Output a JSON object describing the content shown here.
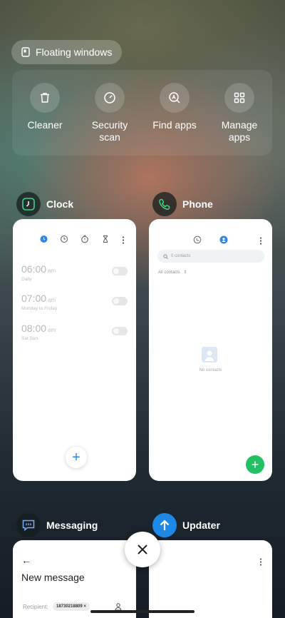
{
  "floating_windows": {
    "label": "Floating windows"
  },
  "shortcuts": [
    {
      "label": "Cleaner",
      "icon": "trash-icon"
    },
    {
      "label": "Security scan",
      "icon": "security-gauge-icon"
    },
    {
      "label": "Find apps",
      "icon": "find-apps-icon"
    },
    {
      "label": "Manage apps",
      "icon": "grid-icon"
    }
  ],
  "apps": {
    "clock": {
      "name": "Clock",
      "alarms": [
        {
          "time": "06:00",
          "ampm": "am",
          "repeat": "Daily"
        },
        {
          "time": "07:00",
          "ampm": "am",
          "repeat": "Monday to Friday"
        },
        {
          "time": "08:00",
          "ampm": "am",
          "repeat": "Sat Sun"
        }
      ],
      "add_label": "+"
    },
    "phone": {
      "name": "Phone",
      "search_placeholder": "0 contacts",
      "filter_label": "All contacts",
      "empty_text": "No contacts",
      "add_label": "+"
    },
    "messaging": {
      "name": "Messaging",
      "back_label": "←",
      "title": "New message",
      "recipient_label": "Recipient:",
      "recipient_chip": "18730218809 ×"
    },
    "updater": {
      "name": "Updater"
    }
  },
  "colors": {
    "accent_blue": "#2f86e6",
    "fab_green": "#21c063",
    "clock_icon_green": "#3ed28a",
    "updater_blue": "#1e88e5"
  }
}
